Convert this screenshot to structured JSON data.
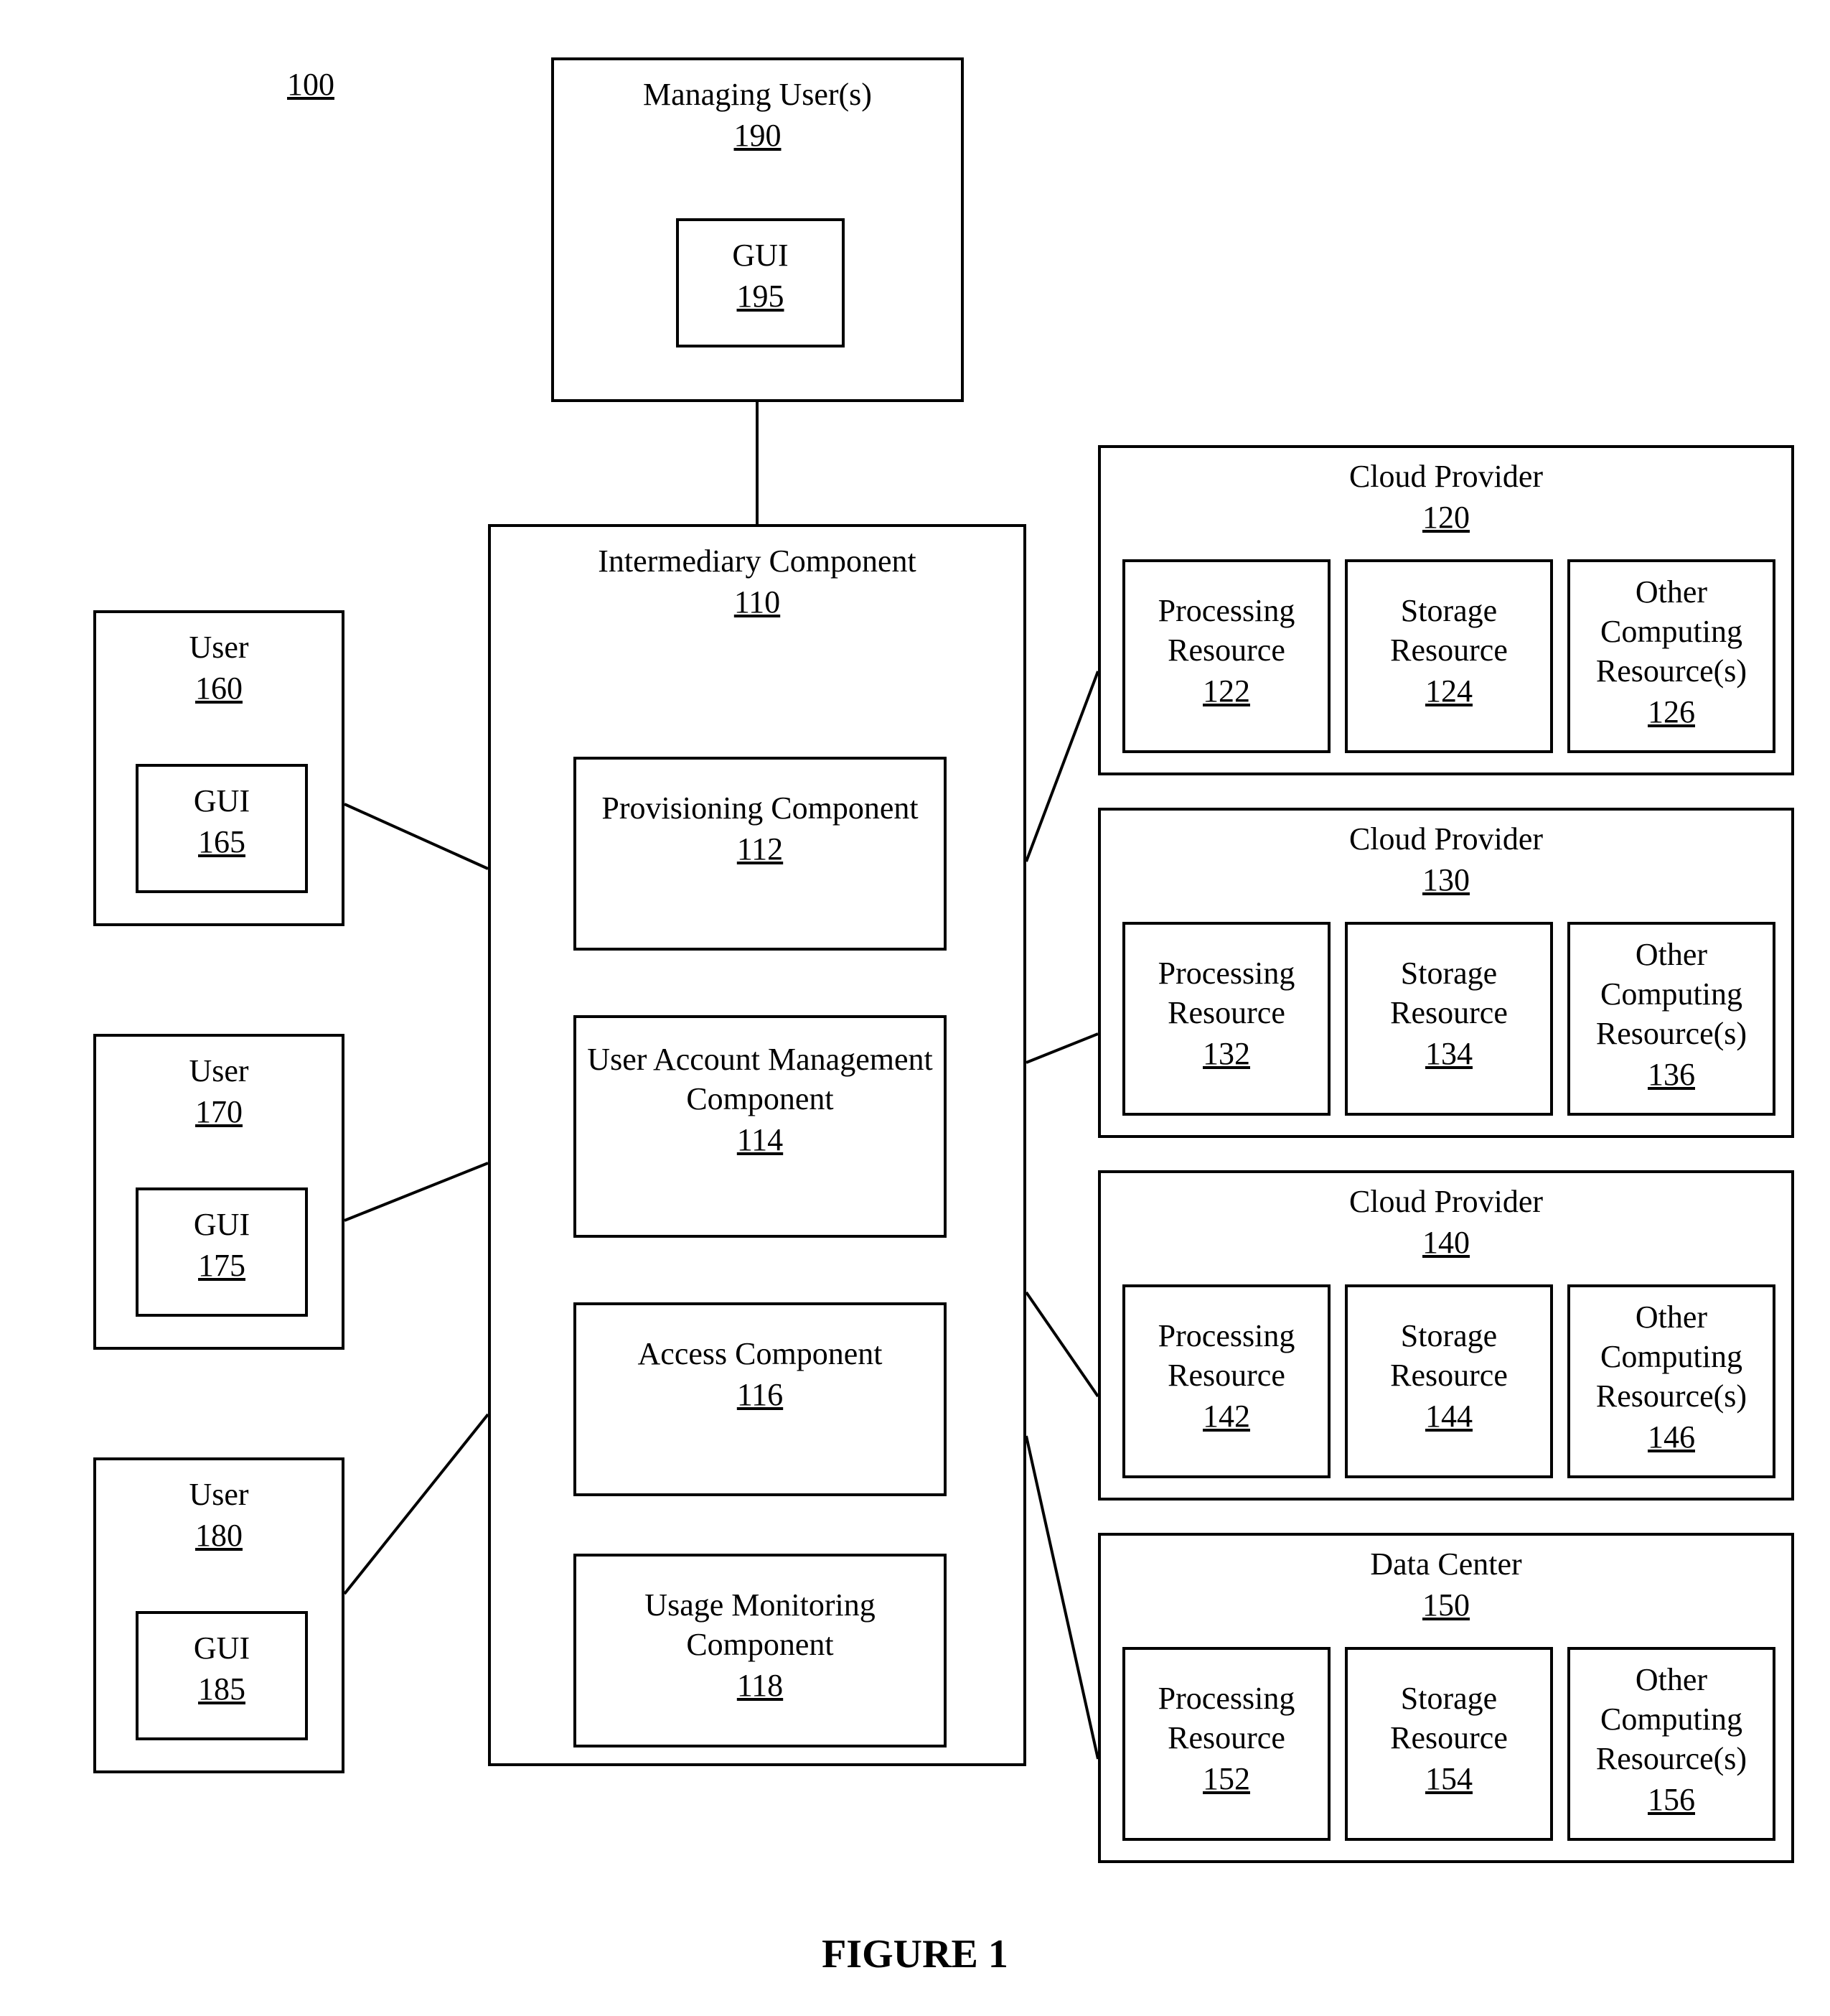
{
  "figure_ref": "100",
  "figure_caption": "FIGURE 1",
  "managing_users": {
    "title": "Managing User(s)",
    "ref": "190",
    "gui": {
      "title": "GUI",
      "ref": "195"
    }
  },
  "intermediary": {
    "title": "Intermediary Component",
    "ref": "110",
    "provisioning": {
      "title": "Provisioning Component",
      "ref": "112"
    },
    "user_account": {
      "title": "User Account Management Component",
      "ref": "114"
    },
    "access": {
      "title": "Access Component",
      "ref": "116"
    },
    "usage": {
      "title": "Usage Monitoring Component",
      "ref": "118"
    }
  },
  "users": [
    {
      "title": "User",
      "ref": "160",
      "gui": {
        "title": "GUI",
        "ref": "165"
      }
    },
    {
      "title": "User",
      "ref": "170",
      "gui": {
        "title": "GUI",
        "ref": "175"
      }
    },
    {
      "title": "User",
      "ref": "180",
      "gui": {
        "title": "GUI",
        "ref": "185"
      }
    }
  ],
  "providers": [
    {
      "title": "Cloud Provider",
      "ref": "120",
      "processing": {
        "title": "Processing Resource",
        "ref": "122"
      },
      "storage": {
        "title": "Storage Resource",
        "ref": "124"
      },
      "other": {
        "title": "Other Computing Resource(s)",
        "ref": "126"
      }
    },
    {
      "title": "Cloud Provider",
      "ref": "130",
      "processing": {
        "title": "Processing Resource",
        "ref": "132"
      },
      "storage": {
        "title": "Storage Resource",
        "ref": "134"
      },
      "other": {
        "title": "Other Computing Resource(s)",
        "ref": "136"
      }
    },
    {
      "title": "Cloud Provider",
      "ref": "140",
      "processing": {
        "title": "Processing Resource",
        "ref": "142"
      },
      "storage": {
        "title": "Storage Resource",
        "ref": "144"
      },
      "other": {
        "title": "Other Computing Resource(s)",
        "ref": "146"
      }
    },
    {
      "title": "Data Center",
      "ref": "150",
      "processing": {
        "title": "Processing Resource",
        "ref": "152"
      },
      "storage": {
        "title": "Storage Resource",
        "ref": "154"
      },
      "other": {
        "title": "Other Computing Resource(s)",
        "ref": "156"
      }
    }
  ]
}
